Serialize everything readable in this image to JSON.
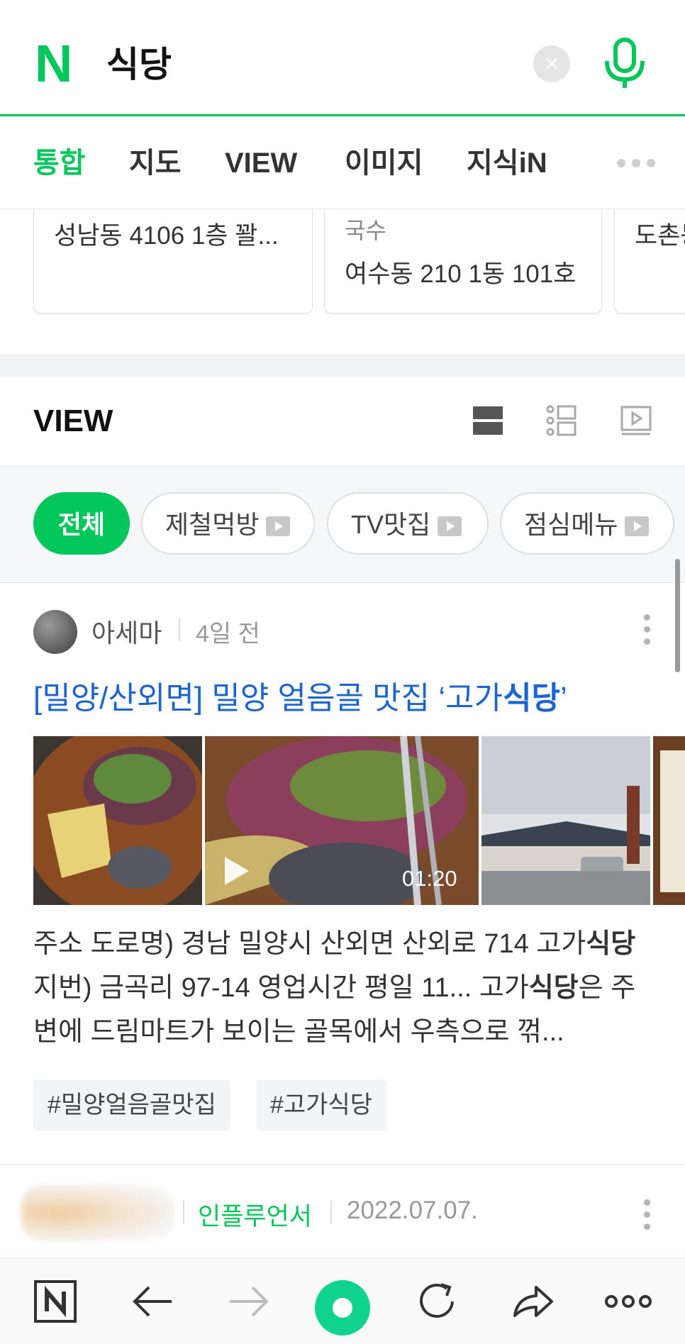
{
  "search": {
    "query": "식당",
    "logo": "N"
  },
  "tabs": [
    {
      "label": "통합",
      "active": true
    },
    {
      "label": "지도"
    },
    {
      "label": "VIEW"
    },
    {
      "label": "이미지"
    },
    {
      "label": "지식iN"
    }
  ],
  "place_cards": [
    {
      "category": "",
      "address": "성남동 4106 1층 꽐..."
    },
    {
      "category": "국수",
      "address": "여수동 210 1동 101호"
    },
    {
      "category": "",
      "address": "도촌동"
    }
  ],
  "view": {
    "title": "VIEW",
    "icons": [
      "list-view-icon",
      "detail-view-icon",
      "video-view-icon"
    ]
  },
  "filters": [
    "전체",
    "제철먹방",
    "TV맛집",
    "점심메뉴"
  ],
  "post": {
    "author": "아세마",
    "date": "4일 전",
    "title_pre": "[밀양/산외면] 밀양 얼음골 맛집 ‘고가",
    "title_bold": "식당",
    "title_post": "’",
    "video_duration": "01:20",
    "snippet": {
      "p1": "주소 도로명) 경남 밀양시 산외면 산외로 714 고가",
      "b1": "식당",
      "p2": " 지번) 금곡리 97-14 영업시간 평일 11... 고가",
      "b2": "식당",
      "p3": "은 주변에 드림마트가 보이는 골목에서 우측으로 꺾..."
    },
    "tags": [
      "#밀양얼음골맛집",
      "#고가식당"
    ]
  },
  "next_post": {
    "badge": "인플루언서",
    "date": "2022.07.07."
  },
  "bottom_bar": [
    "naver-home-icon",
    "back-icon",
    "forward-icon",
    "green-dot-icon",
    "reload-icon",
    "share-icon",
    "more-icon"
  ],
  "colors": {
    "accent": "#03c75a",
    "title_blue": "#1a64d6"
  }
}
